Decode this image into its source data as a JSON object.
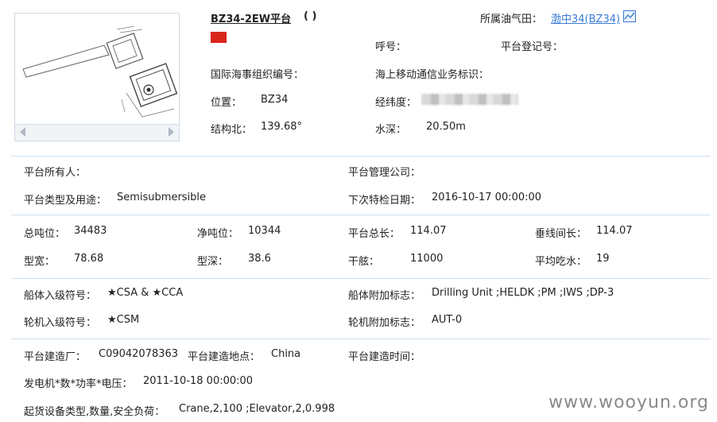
{
  "header": {
    "platform_name": "BZ34-2EW平台",
    "platform_paren": "( )",
    "oilfield_label": "所属油气田：",
    "oilfield_link": "渤中34(BZ34)",
    "callsign_label": "呼号：",
    "registration_label": "平台登记号：",
    "imo_label": "国际海事组织编号：",
    "mmsi_label": "海上移动通信业务标识：",
    "location_label": "位置：",
    "location_value": "BZ34",
    "latlon_label": "经纬度：",
    "heading_label": "结构北：",
    "heading_value": "139.68°",
    "depth_label": "水深：",
    "depth_value": "20.50m"
  },
  "owner_section": {
    "owner_label": "平台所有人：",
    "manager_label": "平台管理公司：",
    "type_label": "平台类型及用途：",
    "type_value": "Semisubmersible",
    "inspection_label": "下次特检日期：",
    "inspection_value": "2016-10-17 00:00:00"
  },
  "dimensions": {
    "gross_tonnage_label": "总吨位：",
    "gross_tonnage_value": "34483",
    "net_tonnage_label": "净吨位：",
    "net_tonnage_value": "10344",
    "length_label": "平台总长：",
    "length_value": "114.07",
    "lbp_label": "垂线间长：",
    "lbp_value": "114.07",
    "breadth_label": "型宽：",
    "breadth_value": "78.68",
    "moulded_depth_label": "型深：",
    "moulded_depth_value": "38.6",
    "freeboard_label": "干舷：",
    "freeboard_value": "11000",
    "draft_label": "平均吃水：",
    "draft_value": "19"
  },
  "classification": {
    "hull_class_label": "船体入级符号：",
    "hull_class_value": "★CSA & ★CCA",
    "hull_notation_label": "船体附加标志：",
    "hull_notation_value": "Drilling Unit ;HELDK ;PM ;IWS ;DP-3",
    "machinery_class_label": "轮机入级符号：",
    "machinery_class_value": "★CSM",
    "machinery_notation_label": "轮机附加标志：",
    "machinery_notation_value": "AUT-0"
  },
  "construction": {
    "builder_label": "平台建造厂：",
    "builder_value": "C09042078363",
    "build_place_label": "平台建造地点：",
    "build_place_value": "China",
    "build_time_label": "平台建造时间：",
    "generator_label": "发电机*数*功率*电压：",
    "generator_value": "2011-10-18 00:00:00",
    "lifting_label": "起货设备类型,数量,安全负荷：",
    "lifting_value": "Crane,2,100 ;Elevator,2,0.998"
  },
  "watermark": "www.wooyun.org",
  "colors": {
    "flag": "#d9261c",
    "link": "#3a7bd5",
    "separator": "#cfe0ef"
  }
}
